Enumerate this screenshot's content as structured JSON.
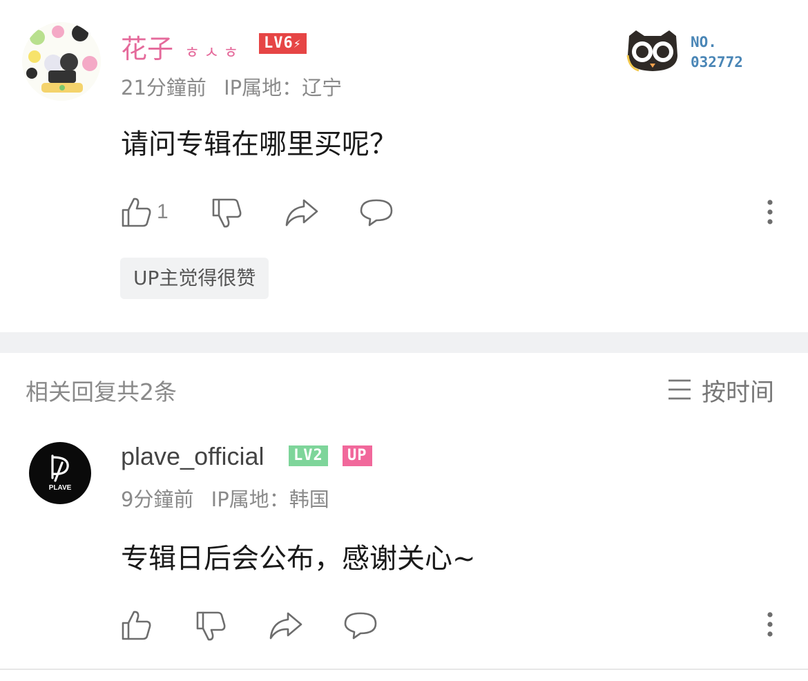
{
  "comment": {
    "author": "花子",
    "author_suffix": "ㅎㅅㅎ",
    "level": "LV6",
    "time": "21分鐘前",
    "ip_location": "IP属地：辽宁",
    "text": "请问专辑在哪里买呢？",
    "like_count": "1",
    "up_tag": "UP主觉得很赞",
    "fan_badge": {
      "label": "NO.",
      "number": "032772"
    },
    "colors": {
      "author": "#e56a9b",
      "level_bg": "#e64545"
    }
  },
  "replies_header": {
    "title": "相关回复共2条",
    "sort_label": "按时间"
  },
  "reply": {
    "author": "plave_official",
    "level": "LV2",
    "up_badge": "UP",
    "avatar_text": "PLAVE",
    "time": "9分鐘前",
    "ip_location": "IP属地：韩国",
    "text": "专辑日后会公布，感谢关心~",
    "colors": {
      "level_bg": "#7ed59a",
      "up_bg": "#f1689b"
    }
  },
  "icons": [
    "like-icon",
    "dislike-icon",
    "share-icon",
    "reply-icon",
    "more-icon",
    "sort-icon"
  ]
}
